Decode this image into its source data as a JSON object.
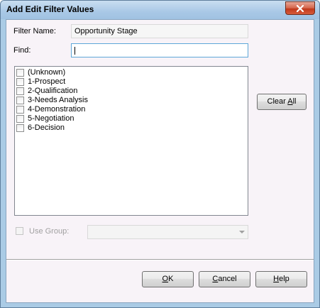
{
  "window": {
    "title": "Add Edit Filter Values"
  },
  "form": {
    "filter_name_label": "Filter Name:",
    "filter_name_value": "Opportunity Stage",
    "find_label": "Find:",
    "find_value": ""
  },
  "list": {
    "items": [
      {
        "label": "(Unknown)",
        "checked": false
      },
      {
        "label": "1-Prospect",
        "checked": false
      },
      {
        "label": "2-Qualification",
        "checked": false
      },
      {
        "label": "3-Needs Analysis",
        "checked": false
      },
      {
        "label": "4-Demonstration",
        "checked": false
      },
      {
        "label": "5-Negotiation",
        "checked": false
      },
      {
        "label": "6-Decision",
        "checked": false
      }
    ]
  },
  "buttons": {
    "clear_all_prefix": "Clear ",
    "clear_all_underlined": "A",
    "clear_all_suffix": "ll",
    "ok_underlined": "O",
    "ok_suffix": "K",
    "cancel_prefix": "",
    "cancel_underlined": "C",
    "cancel_suffix": "ancel",
    "help_underlined": "H",
    "help_suffix": "elp"
  },
  "group": {
    "use_group_label": "Use Group:",
    "use_group_checked": false,
    "group_select_value": ""
  },
  "icons": {
    "close": "close-icon",
    "dropdown": "chevron-down-icon"
  },
  "colors": {
    "titlebar": "#a9c8e6",
    "close_button": "#c0381b",
    "client_background": "#f8f3f8"
  }
}
